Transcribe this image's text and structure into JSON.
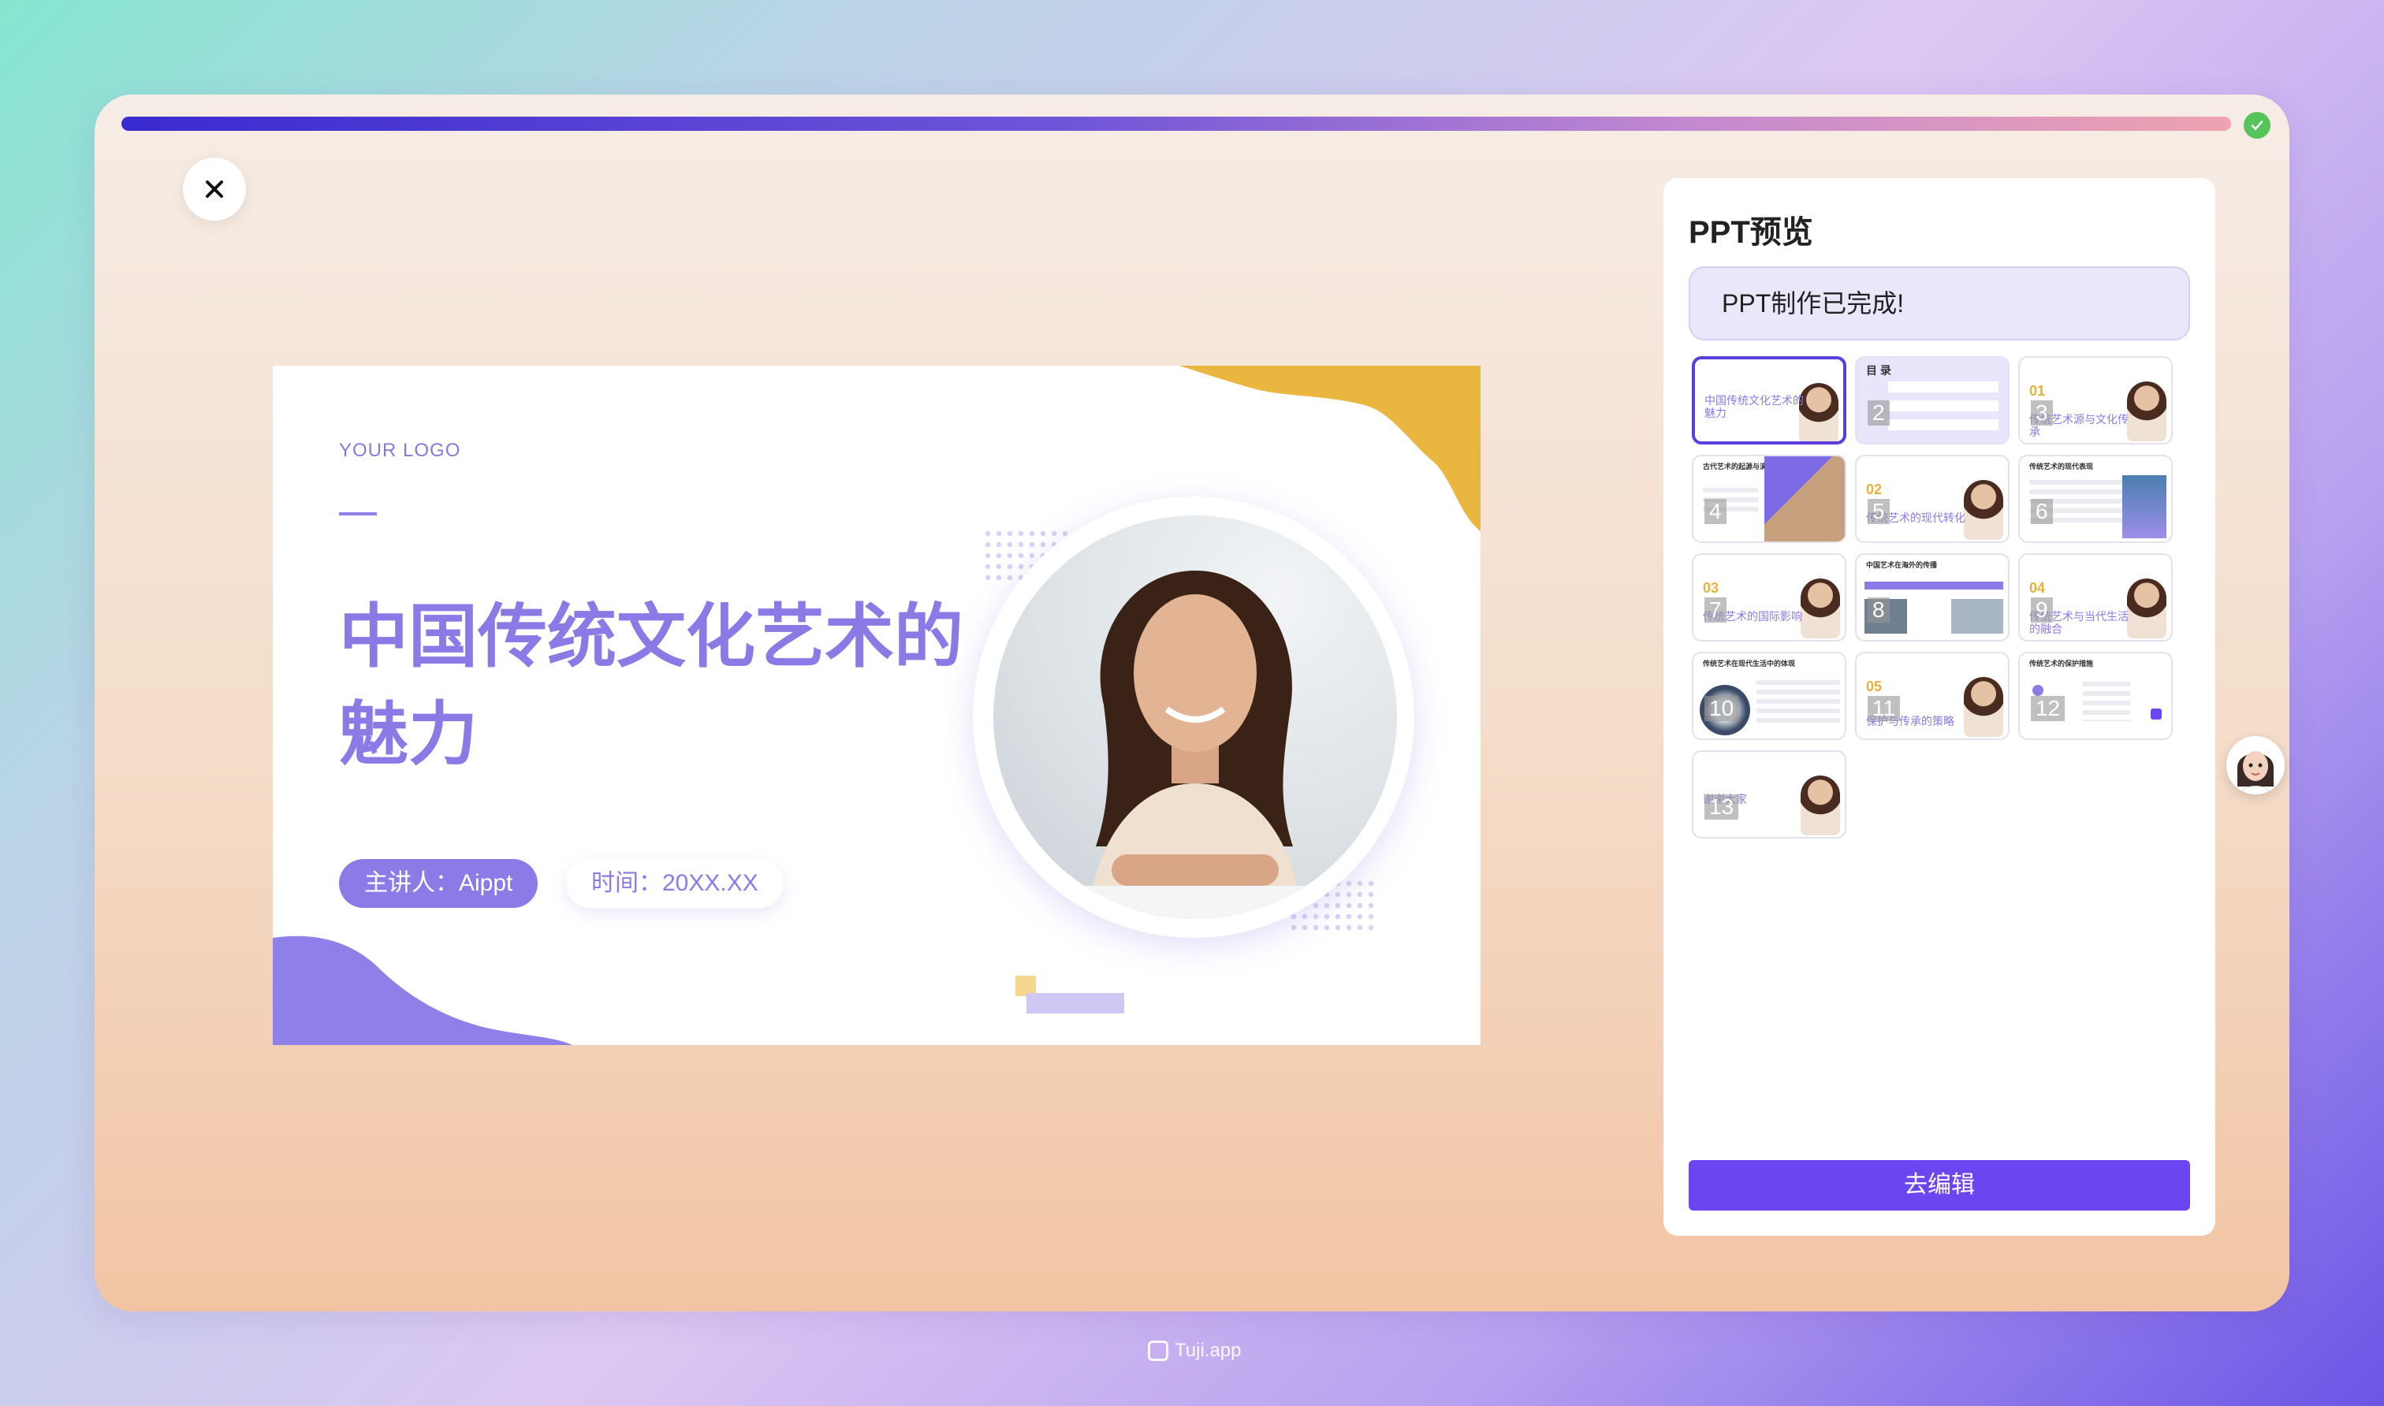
{
  "progress": {
    "percent": 100,
    "done_icon": "check-icon"
  },
  "slide": {
    "logo": "YOUR LOGO",
    "title": "中国传统文化艺术的魅力",
    "presenter": "主讲人：Aippt",
    "date": "时间：20XX.XX"
  },
  "preview": {
    "title": "PPT预览",
    "status": "PPT制作已完成!",
    "edit_button": "去编辑",
    "thumbnails": [
      {
        "num": "",
        "text": "中国传统文化艺术的魅力",
        "section": "",
        "head": ""
      },
      {
        "num": "2",
        "text": "",
        "section": "",
        "head": "目 录"
      },
      {
        "num": "3",
        "text": "传统艺术源与文化传承",
        "section": "01",
        "head": ""
      },
      {
        "num": "4",
        "text": "",
        "section": "",
        "head": "古代艺术的起源与演进"
      },
      {
        "num": "5",
        "text": "传统艺术的现代转化",
        "section": "02",
        "head": ""
      },
      {
        "num": "6",
        "text": "",
        "section": "",
        "head": "传统艺术的现代表现"
      },
      {
        "num": "7",
        "text": "传统艺术的国际影响",
        "section": "03",
        "head": ""
      },
      {
        "num": "8",
        "text": "",
        "section": "",
        "head": "中国艺术在海外的传播"
      },
      {
        "num": "9",
        "text": "传统艺术与当代生活的融合",
        "section": "04",
        "head": ""
      },
      {
        "num": "10",
        "text": "",
        "section": "",
        "head": "传统艺术在现代生活中的体现"
      },
      {
        "num": "11",
        "text": "保护与传承的策略",
        "section": "05",
        "head": ""
      },
      {
        "num": "12",
        "text": "",
        "section": "",
        "head": "传统艺术的保护措施"
      },
      {
        "num": "13",
        "text": "谢谢大家",
        "section": "",
        "head": ""
      }
    ]
  },
  "watermark": "Tuji.app",
  "colors": {
    "accent": "#6a45f0",
    "slide_purple": "#8a7ae6",
    "slide_yellow": "#e9b640"
  }
}
